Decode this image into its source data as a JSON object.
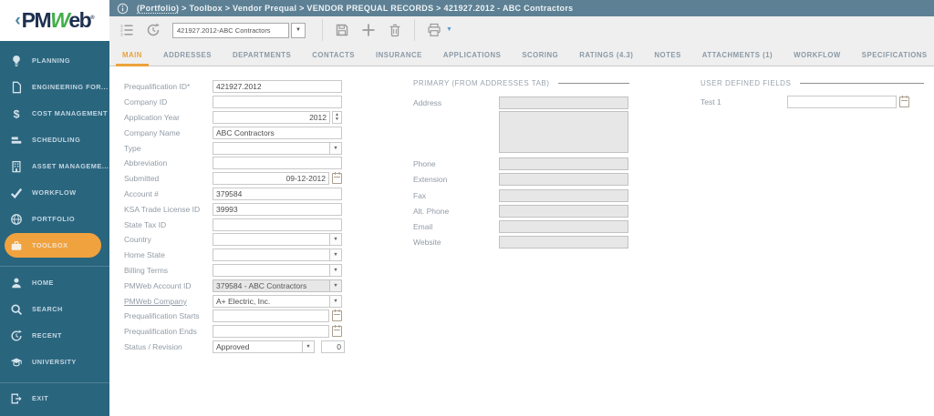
{
  "logo": {
    "chevron": "‹",
    "part1": "PM",
    "part2": "W",
    "part3": "eb",
    "reg": "®"
  },
  "topbar": {
    "breadcrumb_link": "(Portfolio)",
    "breadcrumb_rest": "> Toolbox > Vendor Prequal > VENDOR PREQUAL RECORDS > 421927.2012 - ABC Contractors"
  },
  "toolbar": {
    "record_selector_value": "421927.2012-ABC Contractors"
  },
  "sidebar": {
    "primary": [
      {
        "label": "PLANNING",
        "icon": "lightbulb-icon"
      },
      {
        "label": "ENGINEERING FOR...",
        "icon": "document-icon"
      },
      {
        "label": "COST MANAGEMENT",
        "icon": "dollar-icon"
      },
      {
        "label": "SCHEDULING",
        "icon": "bars-icon"
      },
      {
        "label": "ASSET MANAGEME...",
        "icon": "building-icon"
      },
      {
        "label": "WORKFLOW",
        "icon": "check-icon"
      },
      {
        "label": "PORTFOLIO",
        "icon": "globe-icon"
      },
      {
        "label": "TOOLBOX",
        "icon": "briefcase-icon",
        "active": true
      }
    ],
    "secondary": [
      {
        "label": "HOME",
        "icon": "person-icon"
      },
      {
        "label": "SEARCH",
        "icon": "search-icon"
      },
      {
        "label": "RECENT",
        "icon": "history-icon"
      },
      {
        "label": "UNIVERSITY",
        "icon": "graduation-cap-icon"
      }
    ],
    "footer": [
      {
        "label": "EXIT",
        "icon": "exit-icon"
      }
    ]
  },
  "tabs": [
    {
      "label": "MAIN",
      "active": true
    },
    {
      "label": "ADDRESSES"
    },
    {
      "label": "DEPARTMENTS"
    },
    {
      "label": "CONTACTS"
    },
    {
      "label": "INSURANCE"
    },
    {
      "label": "APPLICATIONS"
    },
    {
      "label": "SCORING"
    },
    {
      "label": "RATINGS (4.3)"
    },
    {
      "label": "NOTES"
    },
    {
      "label": "ATTACHMENTS (1)"
    },
    {
      "label": "WORKFLOW"
    },
    {
      "label": "SPECIFICATIONS"
    }
  ],
  "form": {
    "rows": [
      {
        "label": "Prequalification ID*",
        "type": "text",
        "value": "421927.2012"
      },
      {
        "label": "Company ID",
        "type": "text",
        "value": ""
      },
      {
        "label": "Application Year",
        "type": "spinner",
        "value": "2012"
      },
      {
        "label": "Company Name",
        "type": "text",
        "value": "ABC Contractors"
      },
      {
        "label": "Type",
        "type": "select",
        "value": ""
      },
      {
        "label": "Abbreviation",
        "type": "text",
        "value": ""
      },
      {
        "label": "Submitted",
        "type": "date",
        "value": "09-12-2012",
        "align": "right"
      },
      {
        "label": "Account #",
        "type": "text",
        "value": "379584"
      },
      {
        "label": "KSA Trade License ID",
        "type": "text",
        "value": "39993"
      },
      {
        "label": "State Tax ID",
        "type": "text",
        "value": ""
      },
      {
        "label": "Country",
        "type": "select",
        "value": ""
      },
      {
        "label": "Home State",
        "type": "select",
        "value": ""
      },
      {
        "label": "Billing Terms",
        "type": "select",
        "value": ""
      },
      {
        "label": "PMWeb Account ID",
        "type": "select-disabled",
        "value": "379584 - ABC Contractors"
      },
      {
        "label": "PMWeb Company",
        "type": "select",
        "value": "A+ Electric, Inc.",
        "link": true
      },
      {
        "label": "Prequalification Starts",
        "type": "date",
        "value": ""
      },
      {
        "label": "Prequalification Ends",
        "type": "date",
        "value": ""
      },
      {
        "label": "Status / Revision",
        "type": "status",
        "value": "Approved",
        "value2": "0"
      }
    ]
  },
  "primary_section": {
    "title": "PRIMARY (FROM ADDRESSES TAB)",
    "rows": [
      {
        "label": "Address",
        "type": "text-disabled",
        "value": ""
      },
      {
        "label": "",
        "type": "textarea-disabled",
        "value": ""
      },
      {
        "label": "Phone",
        "type": "text-disabled",
        "value": ""
      },
      {
        "label": "Extension",
        "type": "text-disabled",
        "value": ""
      },
      {
        "label": "Fax",
        "type": "text-disabled",
        "value": ""
      },
      {
        "label": "Alt. Phone",
        "type": "text-disabled",
        "value": ""
      },
      {
        "label": "Email",
        "type": "text-disabled",
        "value": ""
      },
      {
        "label": "Website",
        "type": "text-disabled",
        "value": ""
      }
    ]
  },
  "udf_section": {
    "title": "USER DEFINED FIELDS",
    "rows": [
      {
        "label": "Test 1",
        "type": "date",
        "value": ""
      }
    ]
  },
  "colors": {
    "sidebar_teal": "#2a657e",
    "topbar_slate": "#5d8094",
    "accent_orange": "#f0a23f",
    "active_tab_orange": "#e8a23c"
  }
}
